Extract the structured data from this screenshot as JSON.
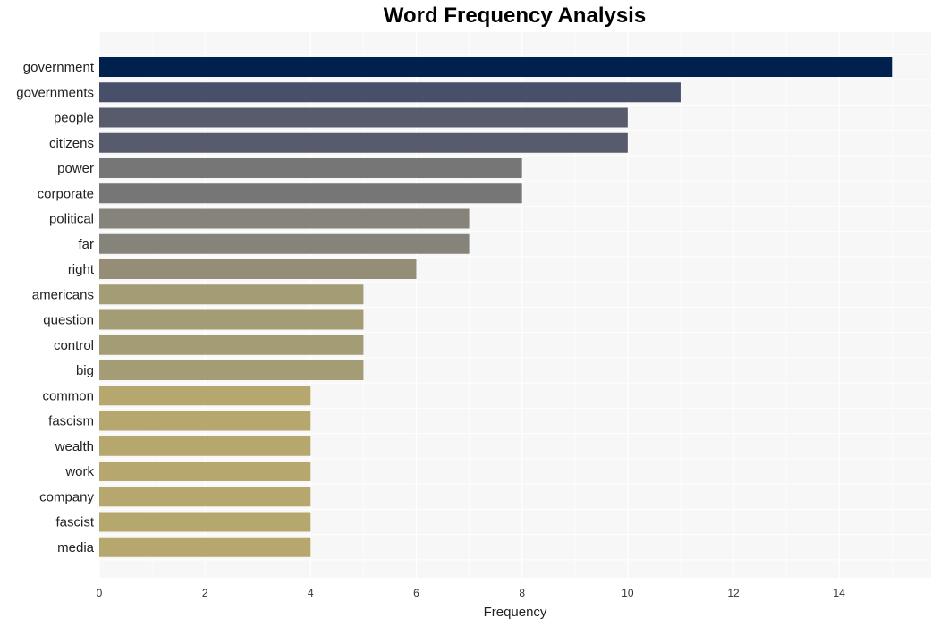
{
  "chart_data": {
    "type": "bar",
    "orientation": "horizontal",
    "title": "Word Frequency Analysis",
    "xlabel": "Frequency",
    "ylabel": "",
    "xlim": [
      0,
      15.74
    ],
    "x_ticks": [
      0,
      2,
      4,
      6,
      8,
      10,
      12,
      14
    ],
    "grid": true,
    "categories": [
      "government",
      "governments",
      "people",
      "citizens",
      "power",
      "corporate",
      "political",
      "far",
      "right",
      "americans",
      "question",
      "control",
      "big",
      "common",
      "fascism",
      "wealth",
      "work",
      "company",
      "fascist",
      "media"
    ],
    "values": [
      15,
      11,
      10,
      10,
      8,
      8,
      7,
      7,
      6,
      5,
      5,
      5,
      5,
      4,
      4,
      4,
      4,
      4,
      4,
      4
    ],
    "colors": [
      "#00214d",
      "#474f69",
      "#575b6b",
      "#575b6b",
      "#767676",
      "#767676",
      "#86837a",
      "#86837a",
      "#958d76",
      "#a49c74",
      "#a49c74",
      "#a49c74",
      "#a49c74",
      "#b5a76e",
      "#b5a76e",
      "#b5a76e",
      "#b5a76e",
      "#b5a76e",
      "#b5a76e",
      "#b5a76e"
    ]
  }
}
